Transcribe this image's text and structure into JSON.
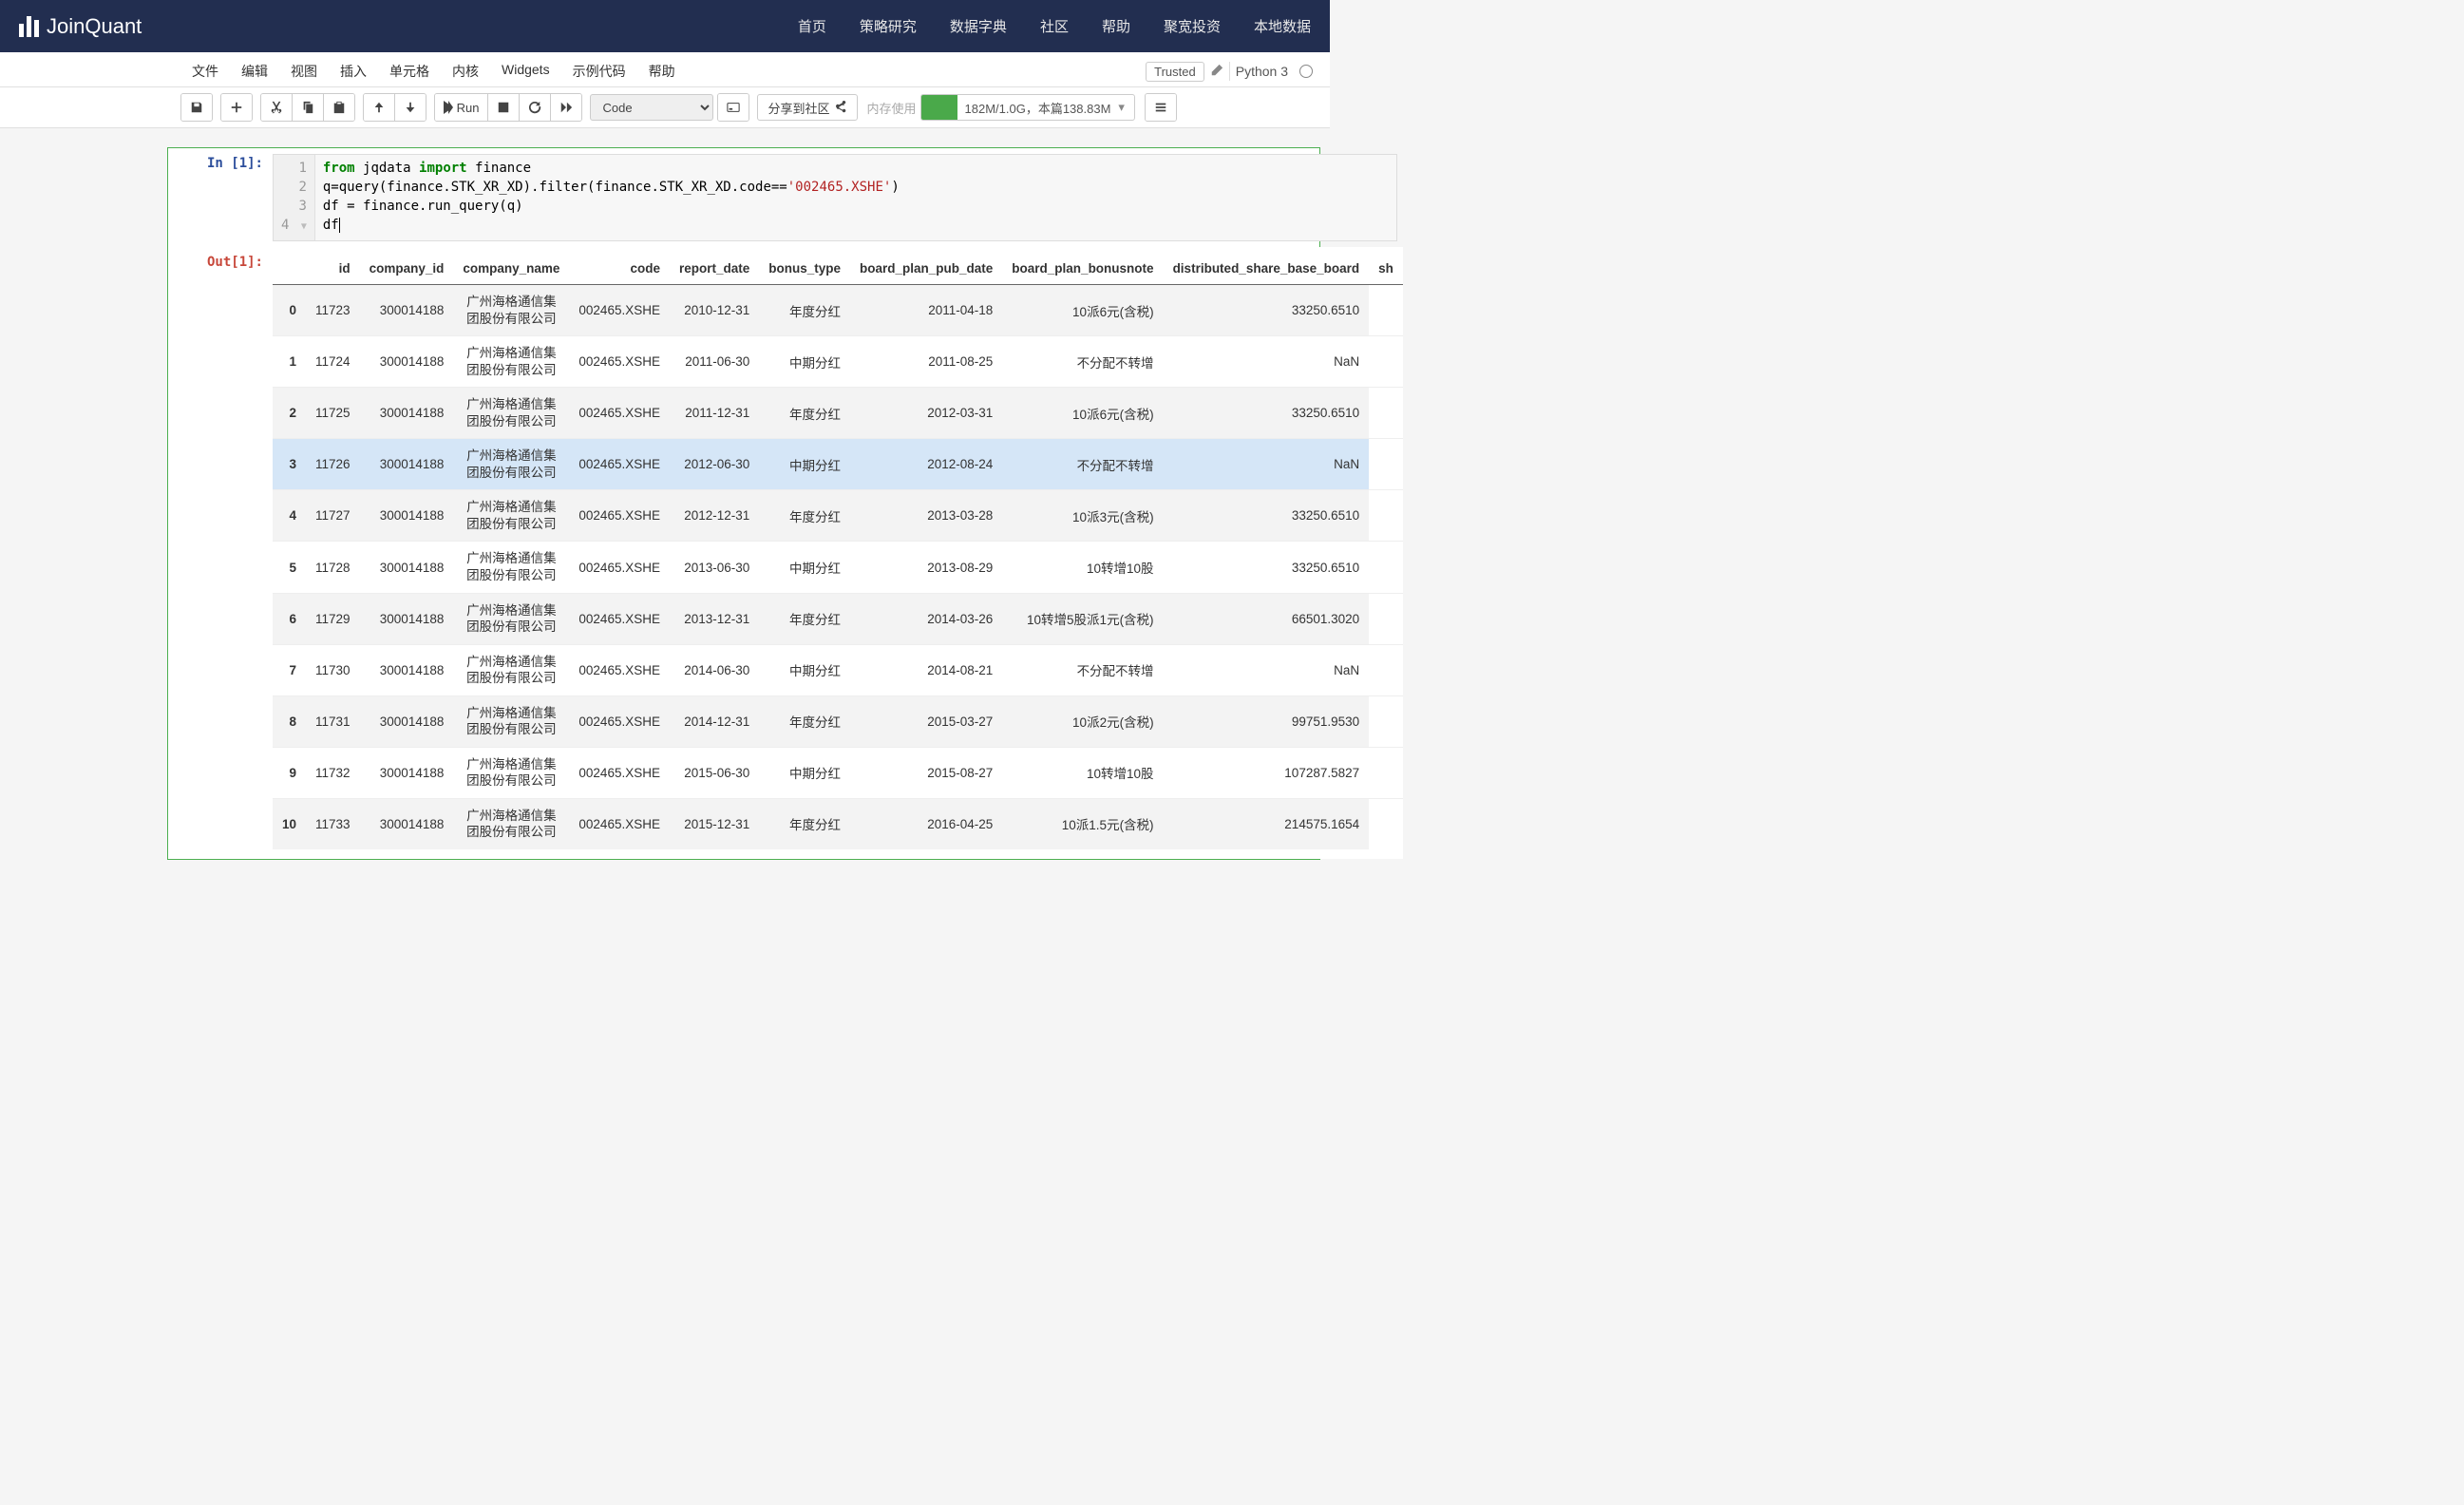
{
  "brand": "JoinQuant",
  "nav": [
    "首页",
    "策略研究",
    "数据字典",
    "社区",
    "帮助",
    "聚宽投资",
    "本地数据"
  ],
  "menu": [
    "文件",
    "编辑",
    "视图",
    "插入",
    "单元格",
    "内核",
    "Widgets",
    "示例代码",
    "帮助"
  ],
  "trusted": "Trusted",
  "kernel": "Python 3",
  "toolbar": {
    "run": "Run",
    "cell_type": "Code",
    "share": "分享到社区",
    "mem_label": "内存使用",
    "mem_text": "182M/1.0G，本篇138.83M"
  },
  "prompts": {
    "in": "In [1]:",
    "out": "Out[1]:"
  },
  "code_display": {
    "l1_pre": "from",
    "l1_mod": " jqdata ",
    "l1_imp": "import",
    "l1_post": " finance",
    "l2_a": "q=query(finance.STK_XR_XD).filter(finance.STK_XR_XD.code==",
    "l2_s": "'002465.XSHE'",
    "l2_b": ")",
    "l3": "df = finance.run_query(q)",
    "l4": "df"
  },
  "gutter": "1\n2\n3\n4",
  "table": {
    "headers": [
      "",
      "id",
      "company_id",
      "company_name",
      "code",
      "report_date",
      "bonus_type",
      "board_plan_pub_date",
      "board_plan_bonusnote",
      "distributed_share_base_board",
      "sh"
    ],
    "highlight_row": 3,
    "rows": [
      {
        "idx": "0",
        "id": "11723",
        "company_id": "300014188",
        "company_name": "广州海格通信集团股份有限公司",
        "code": "002465.XSHE",
        "report_date": "2010-12-31",
        "bonus_type": "年度分红",
        "board_plan_pub_date": "2011-04-18",
        "board_plan_bonusnote": "10派6元(含税)",
        "distributed_share_base_board": "33250.6510"
      },
      {
        "idx": "1",
        "id": "11724",
        "company_id": "300014188",
        "company_name": "广州海格通信集团股份有限公司",
        "code": "002465.XSHE",
        "report_date": "2011-06-30",
        "bonus_type": "中期分红",
        "board_plan_pub_date": "2011-08-25",
        "board_plan_bonusnote": "不分配不转增",
        "distributed_share_base_board": "NaN"
      },
      {
        "idx": "2",
        "id": "11725",
        "company_id": "300014188",
        "company_name": "广州海格通信集团股份有限公司",
        "code": "002465.XSHE",
        "report_date": "2011-12-31",
        "bonus_type": "年度分红",
        "board_plan_pub_date": "2012-03-31",
        "board_plan_bonusnote": "10派6元(含税)",
        "distributed_share_base_board": "33250.6510"
      },
      {
        "idx": "3",
        "id": "11726",
        "company_id": "300014188",
        "company_name": "广州海格通信集团股份有限公司",
        "code": "002465.XSHE",
        "report_date": "2012-06-30",
        "bonus_type": "中期分红",
        "board_plan_pub_date": "2012-08-24",
        "board_plan_bonusnote": "不分配不转增",
        "distributed_share_base_board": "NaN"
      },
      {
        "idx": "4",
        "id": "11727",
        "company_id": "300014188",
        "company_name": "广州海格通信集团股份有限公司",
        "code": "002465.XSHE",
        "report_date": "2012-12-31",
        "bonus_type": "年度分红",
        "board_plan_pub_date": "2013-03-28",
        "board_plan_bonusnote": "10派3元(含税)",
        "distributed_share_base_board": "33250.6510"
      },
      {
        "idx": "5",
        "id": "11728",
        "company_id": "300014188",
        "company_name": "广州海格通信集团股份有限公司",
        "code": "002465.XSHE",
        "report_date": "2013-06-30",
        "bonus_type": "中期分红",
        "board_plan_pub_date": "2013-08-29",
        "board_plan_bonusnote": "10转增10股",
        "distributed_share_base_board": "33250.6510"
      },
      {
        "idx": "6",
        "id": "11729",
        "company_id": "300014188",
        "company_name": "广州海格通信集团股份有限公司",
        "code": "002465.XSHE",
        "report_date": "2013-12-31",
        "bonus_type": "年度分红",
        "board_plan_pub_date": "2014-03-26",
        "board_plan_bonusnote": "10转增5股派1元(含税)",
        "distributed_share_base_board": "66501.3020"
      },
      {
        "idx": "7",
        "id": "11730",
        "company_id": "300014188",
        "company_name": "广州海格通信集团股份有限公司",
        "code": "002465.XSHE",
        "report_date": "2014-06-30",
        "bonus_type": "中期分红",
        "board_plan_pub_date": "2014-08-21",
        "board_plan_bonusnote": "不分配不转增",
        "distributed_share_base_board": "NaN"
      },
      {
        "idx": "8",
        "id": "11731",
        "company_id": "300014188",
        "company_name": "广州海格通信集团股份有限公司",
        "code": "002465.XSHE",
        "report_date": "2014-12-31",
        "bonus_type": "年度分红",
        "board_plan_pub_date": "2015-03-27",
        "board_plan_bonusnote": "10派2元(含税)",
        "distributed_share_base_board": "99751.9530"
      },
      {
        "idx": "9",
        "id": "11732",
        "company_id": "300014188",
        "company_name": "广州海格通信集团股份有限公司",
        "code": "002465.XSHE",
        "report_date": "2015-06-30",
        "bonus_type": "中期分红",
        "board_plan_pub_date": "2015-08-27",
        "board_plan_bonusnote": "10转增10股",
        "distributed_share_base_board": "107287.5827"
      },
      {
        "idx": "10",
        "id": "11733",
        "company_id": "300014188",
        "company_name": "广州海格通信集团股份有限公司",
        "code": "002465.XSHE",
        "report_date": "2015-12-31",
        "bonus_type": "年度分红",
        "board_plan_pub_date": "2016-04-25",
        "board_plan_bonusnote": "10派1.5元(含税)",
        "distributed_share_base_board": "214575.1654"
      }
    ]
  }
}
